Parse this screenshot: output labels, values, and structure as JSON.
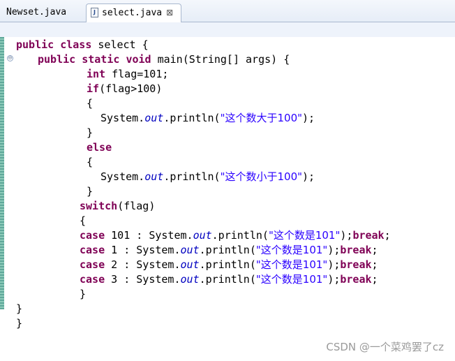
{
  "tabs": [
    {
      "label": "Newset.java",
      "active": false
    },
    {
      "label": "select.java",
      "active": true,
      "icon_letter": "J",
      "close_glyph": "⊠"
    }
  ],
  "code": {
    "l1_kw1": "public",
    "l1_kw2": "class",
    "l1_rest": " select {",
    "l2_kw1": "public",
    "l2_kw2": "static",
    "l2_kw3": "void",
    "l2_rest": " main(String[] args) {",
    "l3_kw": "int",
    "l3_rest": " flag=101;",
    "l4_kw": "if",
    "l4_rest": "(flag>100)",
    "l5": "{",
    "l6_a": "System.",
    "l6_out": "out",
    "l6_b": ".println(",
    "l6_str": "\"这个数大于100\"",
    "l6_c": ");",
    "l7": "}",
    "l8_kw": "else",
    "l9": "{",
    "l10_a": "System.",
    "l10_out": "out",
    "l10_b": ".println(",
    "l10_str": "\"这个数小于100\"",
    "l10_c": ");",
    "l11": "}",
    "l12_kw": "switch",
    "l12_rest": "(flag)",
    "l13": "{",
    "cases": [
      {
        "kw": "case",
        "mid": " 101 : System.",
        "out": "out",
        "b": ".println(",
        "str": "\"这个数是101\"",
        "c": ");",
        "brk": "break",
        "end": ";"
      },
      {
        "kw": "case",
        "mid": " 1 : System.",
        "out": "out",
        "b": ".println(",
        "str": "\"这个数是101\"",
        "c": ");",
        "brk": "break",
        "end": ";"
      },
      {
        "kw": "case",
        "mid": " 2 : System.",
        "out": "out",
        "b": ".println(",
        "str": "\"这个数是101\"",
        "c": ");",
        "brk": "break",
        "end": ";"
      },
      {
        "kw": "case",
        "mid": " 3 : System.",
        "out": "out",
        "b": ".println(",
        "str": "\"这个数是101\"",
        "c": ");",
        "brk": "break",
        "end": ";"
      }
    ],
    "l18": "}",
    "l19": "}",
    "l20": "}"
  },
  "gutter": {
    "fold_glyph": "⊖"
  },
  "watermark": "CSDN @一个菜鸡罢了cz"
}
